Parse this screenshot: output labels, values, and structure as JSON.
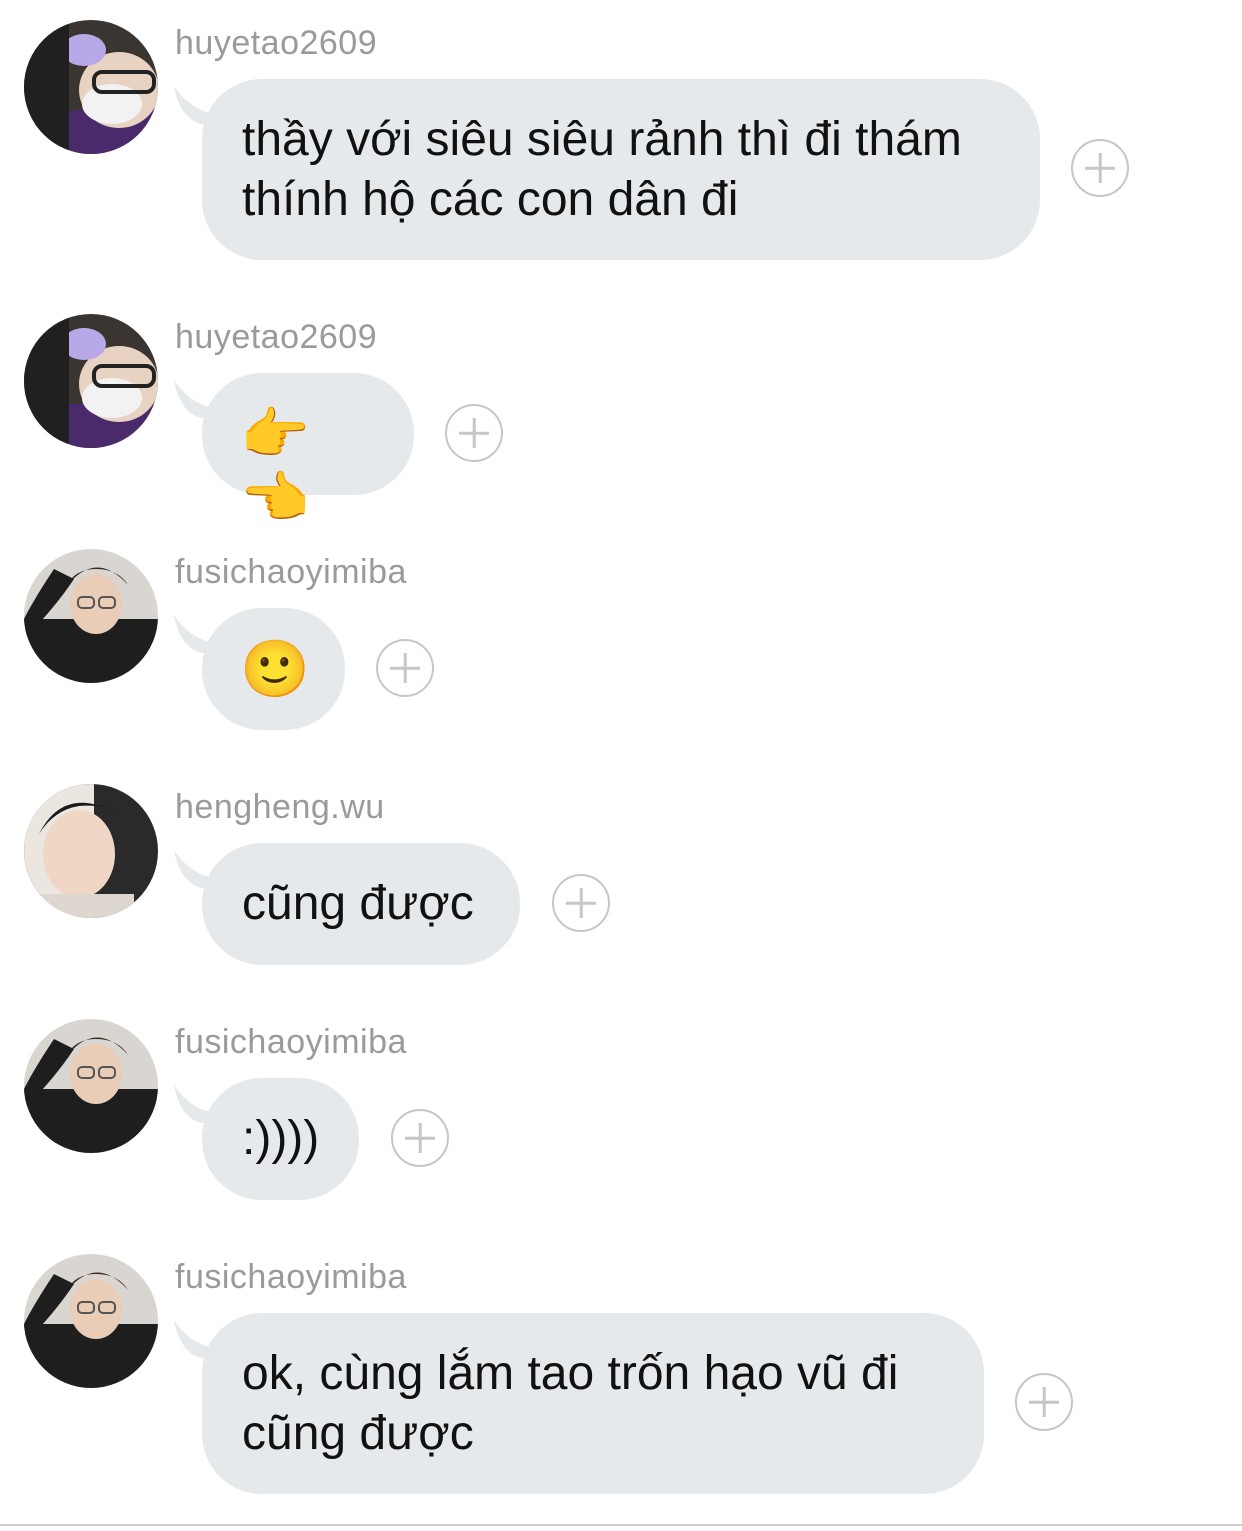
{
  "messages": [
    {
      "username": "huyetao2609",
      "text": "thầy với siêu siêu rảnh thì đi thám thính hộ các con dân đi",
      "avatar": "avatar-huyetao2609"
    },
    {
      "username": "huyetao2609",
      "text": "👉👈",
      "avatar": "avatar-huyetao2609"
    },
    {
      "username": "fusichaoyimiba",
      "text": "🙂",
      "avatar": "avatar-fusichaoyimiba"
    },
    {
      "username": "hengheng.wu",
      "text": "cũng được",
      "avatar": "avatar-hengheng-wu"
    },
    {
      "username": "fusichaoyimiba",
      "text": ":))))",
      "avatar": "avatar-fusichaoyimiba"
    },
    {
      "username": "fusichaoyimiba",
      "text": "ok, cùng lắm tao trốn hạo vũ đi cũng được",
      "avatar": "avatar-fusichaoyimiba"
    }
  ],
  "icons": {
    "react": "add-reaction-icon"
  },
  "colors": {
    "bubble": "#e6e9ec",
    "username": "#9a9a9a",
    "background": "#ffffff"
  }
}
